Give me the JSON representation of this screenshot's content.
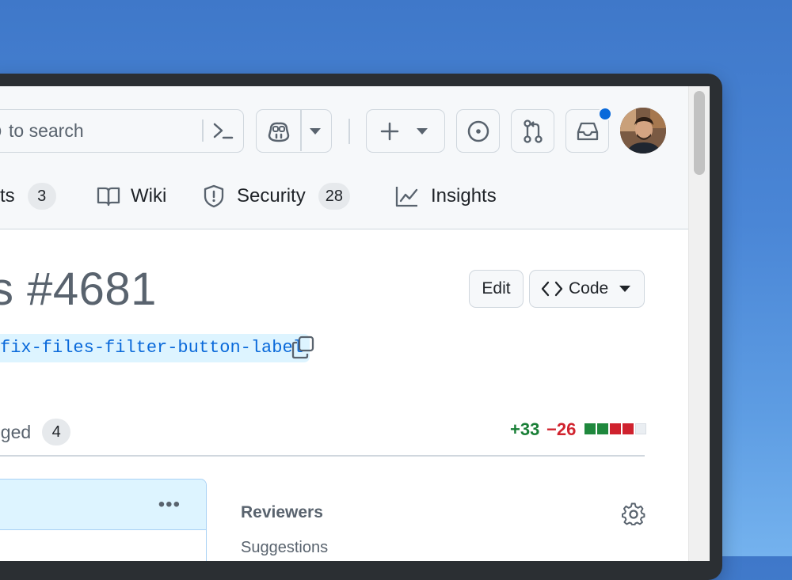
{
  "topbar": {
    "search_placeholder": "to search",
    "new_label": "+",
    "notification_dot": true
  },
  "nav": [
    {
      "label": "cts",
      "count": "3",
      "icon": "project-icon"
    },
    {
      "label": "Wiki",
      "count": null,
      "icon": "book-icon"
    },
    {
      "label": "Security",
      "count": "28",
      "icon": "shield-icon"
    },
    {
      "label": "Insights",
      "count": null,
      "icon": "graph-icon"
    }
  ],
  "pr": {
    "title": "s #4681",
    "branch": "fix-files-filter-button-label",
    "edit_label": "Edit",
    "code_label": "Code"
  },
  "tabs": {
    "files_label": "nged",
    "files_count": "4"
  },
  "diff": {
    "additions": "+33",
    "deletions": "−26",
    "blocks": [
      "add",
      "add",
      "del",
      "del",
      "neutral"
    ]
  },
  "sidebar": {
    "reviewers_label": "Reviewers",
    "suggestions_label": "Suggestions"
  },
  "colors": {
    "accent": "#0969da",
    "add": "#1a7f37",
    "del": "#d1242f",
    "muted": "#59636e"
  }
}
